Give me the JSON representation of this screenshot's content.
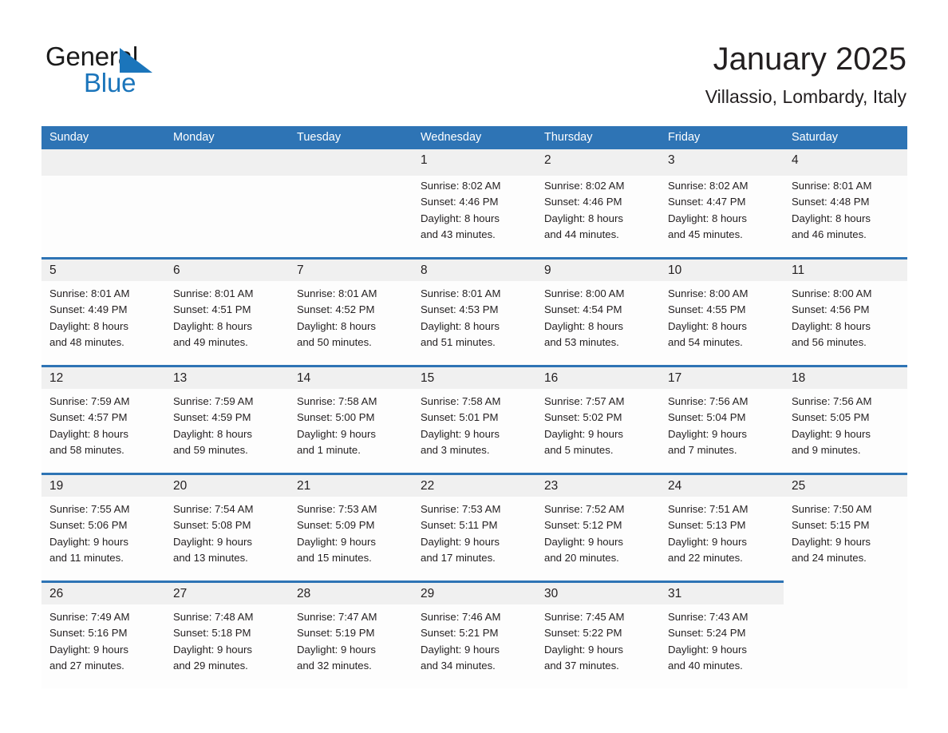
{
  "brand": {
    "name_part1": "General",
    "name_part2": "Blue",
    "accent_color": "#1b75bb",
    "triangle_icon": "triangle-icon"
  },
  "header": {
    "title": "January 2025",
    "subtitle": "Villassio, Lombardy, Italy"
  },
  "theme": {
    "header_bar_color": "#2e74b5",
    "day_band_color": "#f0f0f0",
    "cell_background": "#fdfdfd",
    "text_color": "#231f20"
  },
  "weekdays": [
    "Sunday",
    "Monday",
    "Tuesday",
    "Wednesday",
    "Thursday",
    "Friday",
    "Saturday"
  ],
  "weeks": [
    [
      {
        "day": "",
        "sunrise": "",
        "sunset": "",
        "daylight1": "",
        "daylight2": ""
      },
      {
        "day": "",
        "sunrise": "",
        "sunset": "",
        "daylight1": "",
        "daylight2": ""
      },
      {
        "day": "",
        "sunrise": "",
        "sunset": "",
        "daylight1": "",
        "daylight2": ""
      },
      {
        "day": "1",
        "sunrise": "Sunrise: 8:02 AM",
        "sunset": "Sunset: 4:46 PM",
        "daylight1": "Daylight: 8 hours",
        "daylight2": "and 43 minutes."
      },
      {
        "day": "2",
        "sunrise": "Sunrise: 8:02 AM",
        "sunset": "Sunset: 4:46 PM",
        "daylight1": "Daylight: 8 hours",
        "daylight2": "and 44 minutes."
      },
      {
        "day": "3",
        "sunrise": "Sunrise: 8:02 AM",
        "sunset": "Sunset: 4:47 PM",
        "daylight1": "Daylight: 8 hours",
        "daylight2": "and 45 minutes."
      },
      {
        "day": "4",
        "sunrise": "Sunrise: 8:01 AM",
        "sunset": "Sunset: 4:48 PM",
        "daylight1": "Daylight: 8 hours",
        "daylight2": "and 46 minutes."
      }
    ],
    [
      {
        "day": "5",
        "sunrise": "Sunrise: 8:01 AM",
        "sunset": "Sunset: 4:49 PM",
        "daylight1": "Daylight: 8 hours",
        "daylight2": "and 48 minutes."
      },
      {
        "day": "6",
        "sunrise": "Sunrise: 8:01 AM",
        "sunset": "Sunset: 4:51 PM",
        "daylight1": "Daylight: 8 hours",
        "daylight2": "and 49 minutes."
      },
      {
        "day": "7",
        "sunrise": "Sunrise: 8:01 AM",
        "sunset": "Sunset: 4:52 PM",
        "daylight1": "Daylight: 8 hours",
        "daylight2": "and 50 minutes."
      },
      {
        "day": "8",
        "sunrise": "Sunrise: 8:01 AM",
        "sunset": "Sunset: 4:53 PM",
        "daylight1": "Daylight: 8 hours",
        "daylight2": "and 51 minutes."
      },
      {
        "day": "9",
        "sunrise": "Sunrise: 8:00 AM",
        "sunset": "Sunset: 4:54 PM",
        "daylight1": "Daylight: 8 hours",
        "daylight2": "and 53 minutes."
      },
      {
        "day": "10",
        "sunrise": "Sunrise: 8:00 AM",
        "sunset": "Sunset: 4:55 PM",
        "daylight1": "Daylight: 8 hours",
        "daylight2": "and 54 minutes."
      },
      {
        "day": "11",
        "sunrise": "Sunrise: 8:00 AM",
        "sunset": "Sunset: 4:56 PM",
        "daylight1": "Daylight: 8 hours",
        "daylight2": "and 56 minutes."
      }
    ],
    [
      {
        "day": "12",
        "sunrise": "Sunrise: 7:59 AM",
        "sunset": "Sunset: 4:57 PM",
        "daylight1": "Daylight: 8 hours",
        "daylight2": "and 58 minutes."
      },
      {
        "day": "13",
        "sunrise": "Sunrise: 7:59 AM",
        "sunset": "Sunset: 4:59 PM",
        "daylight1": "Daylight: 8 hours",
        "daylight2": "and 59 minutes."
      },
      {
        "day": "14",
        "sunrise": "Sunrise: 7:58 AM",
        "sunset": "Sunset: 5:00 PM",
        "daylight1": "Daylight: 9 hours",
        "daylight2": "and 1 minute."
      },
      {
        "day": "15",
        "sunrise": "Sunrise: 7:58 AM",
        "sunset": "Sunset: 5:01 PM",
        "daylight1": "Daylight: 9 hours",
        "daylight2": "and 3 minutes."
      },
      {
        "day": "16",
        "sunrise": "Sunrise: 7:57 AM",
        "sunset": "Sunset: 5:02 PM",
        "daylight1": "Daylight: 9 hours",
        "daylight2": "and 5 minutes."
      },
      {
        "day": "17",
        "sunrise": "Sunrise: 7:56 AM",
        "sunset": "Sunset: 5:04 PM",
        "daylight1": "Daylight: 9 hours",
        "daylight2": "and 7 minutes."
      },
      {
        "day": "18",
        "sunrise": "Sunrise: 7:56 AM",
        "sunset": "Sunset: 5:05 PM",
        "daylight1": "Daylight: 9 hours",
        "daylight2": "and 9 minutes."
      }
    ],
    [
      {
        "day": "19",
        "sunrise": "Sunrise: 7:55 AM",
        "sunset": "Sunset: 5:06 PM",
        "daylight1": "Daylight: 9 hours",
        "daylight2": "and 11 minutes."
      },
      {
        "day": "20",
        "sunrise": "Sunrise: 7:54 AM",
        "sunset": "Sunset: 5:08 PM",
        "daylight1": "Daylight: 9 hours",
        "daylight2": "and 13 minutes."
      },
      {
        "day": "21",
        "sunrise": "Sunrise: 7:53 AM",
        "sunset": "Sunset: 5:09 PM",
        "daylight1": "Daylight: 9 hours",
        "daylight2": "and 15 minutes."
      },
      {
        "day": "22",
        "sunrise": "Sunrise: 7:53 AM",
        "sunset": "Sunset: 5:11 PM",
        "daylight1": "Daylight: 9 hours",
        "daylight2": "and 17 minutes."
      },
      {
        "day": "23",
        "sunrise": "Sunrise: 7:52 AM",
        "sunset": "Sunset: 5:12 PM",
        "daylight1": "Daylight: 9 hours",
        "daylight2": "and 20 minutes."
      },
      {
        "day": "24",
        "sunrise": "Sunrise: 7:51 AM",
        "sunset": "Sunset: 5:13 PM",
        "daylight1": "Daylight: 9 hours",
        "daylight2": "and 22 minutes."
      },
      {
        "day": "25",
        "sunrise": "Sunrise: 7:50 AM",
        "sunset": "Sunset: 5:15 PM",
        "daylight1": "Daylight: 9 hours",
        "daylight2": "and 24 minutes."
      }
    ],
    [
      {
        "day": "26",
        "sunrise": "Sunrise: 7:49 AM",
        "sunset": "Sunset: 5:16 PM",
        "daylight1": "Daylight: 9 hours",
        "daylight2": "and 27 minutes."
      },
      {
        "day": "27",
        "sunrise": "Sunrise: 7:48 AM",
        "sunset": "Sunset: 5:18 PM",
        "daylight1": "Daylight: 9 hours",
        "daylight2": "and 29 minutes."
      },
      {
        "day": "28",
        "sunrise": "Sunrise: 7:47 AM",
        "sunset": "Sunset: 5:19 PM",
        "daylight1": "Daylight: 9 hours",
        "daylight2": "and 32 minutes."
      },
      {
        "day": "29",
        "sunrise": "Sunrise: 7:46 AM",
        "sunset": "Sunset: 5:21 PM",
        "daylight1": "Daylight: 9 hours",
        "daylight2": "and 34 minutes."
      },
      {
        "day": "30",
        "sunrise": "Sunrise: 7:45 AM",
        "sunset": "Sunset: 5:22 PM",
        "daylight1": "Daylight: 9 hours",
        "daylight2": "and 37 minutes."
      },
      {
        "day": "31",
        "sunrise": "Sunrise: 7:43 AM",
        "sunset": "Sunset: 5:24 PM",
        "daylight1": "Daylight: 9 hours",
        "daylight2": "and 40 minutes."
      },
      {
        "day": "",
        "sunrise": "",
        "sunset": "",
        "daylight1": "",
        "daylight2": ""
      }
    ]
  ]
}
